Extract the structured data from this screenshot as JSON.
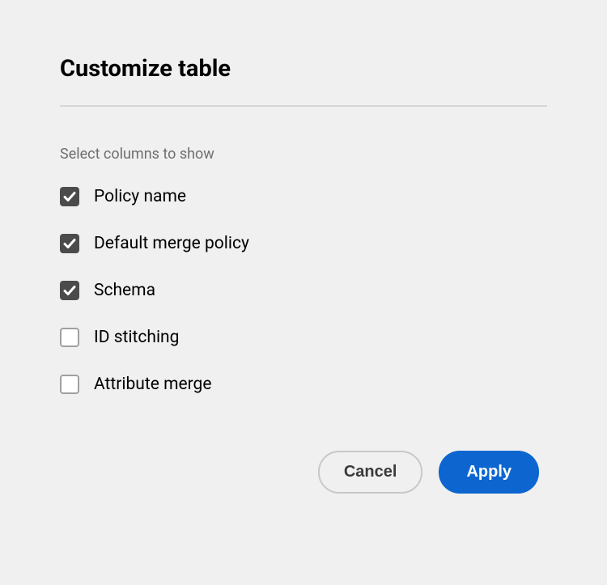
{
  "dialog": {
    "title": "Customize table",
    "subtitle": "Select columns to show",
    "options": [
      {
        "label": "Policy name",
        "checked": true
      },
      {
        "label": "Default merge policy",
        "checked": true
      },
      {
        "label": "Schema",
        "checked": true
      },
      {
        "label": "ID stitching",
        "checked": false
      },
      {
        "label": "Attribute merge",
        "checked": false
      }
    ],
    "buttons": {
      "cancel_label": "Cancel",
      "apply_label": "Apply"
    },
    "colors": {
      "primary": "#0d66d0",
      "checkbox_fill": "#4b4b4b"
    }
  }
}
